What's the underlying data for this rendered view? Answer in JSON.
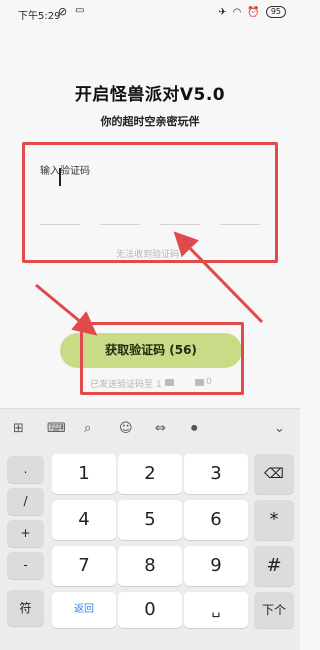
{
  "status_bar": {
    "time": "下午5:29",
    "battery": "95"
  },
  "title": "开启怪兽派对V5.0",
  "subtitle": "你的超时空亲密玩伴",
  "code_input": {
    "label": "输入验证码",
    "no_code_link": "无法收到验证码?"
  },
  "get_code_button": "获取验证码 (56)",
  "sent_to": {
    "prefix": "已发送验证码至",
    "fragment_a": "1",
    "fragment_b": "0"
  },
  "keyboard": {
    "toolbar_icons": [
      "grid-icon",
      "keyboard-icon",
      "search-icon",
      "emoji-icon",
      "cursor-icon",
      "microphone-icon",
      "chevron-down-icon"
    ],
    "rows": [
      [
        ".",
        "1",
        "2",
        "3",
        "⌫"
      ],
      [
        "/",
        "4",
        "5",
        "6",
        "*"
      ],
      [
        "+",
        "7",
        "8",
        "9",
        "#"
      ],
      [
        "-",
        "",
        "",
        "",
        ""
      ],
      [
        "符",
        "返回",
        "0",
        "␣",
        "下个"
      ]
    ],
    "left_keys": [
      ".",
      "/",
      "+",
      "-",
      "符"
    ],
    "digit_keys": [
      [
        "1",
        "2",
        "3"
      ],
      [
        "4",
        "5",
        "6"
      ],
      [
        "7",
        "8",
        "9"
      ]
    ],
    "right_keys": [
      "⌫",
      "*",
      "#"
    ],
    "back_label": "返回",
    "zero": "0",
    "space": "␣",
    "next_label": "下个"
  },
  "colors": {
    "accent_button": "#c8db86",
    "annotation": "#e04a4a",
    "link_blue": "#3b7de0"
  }
}
